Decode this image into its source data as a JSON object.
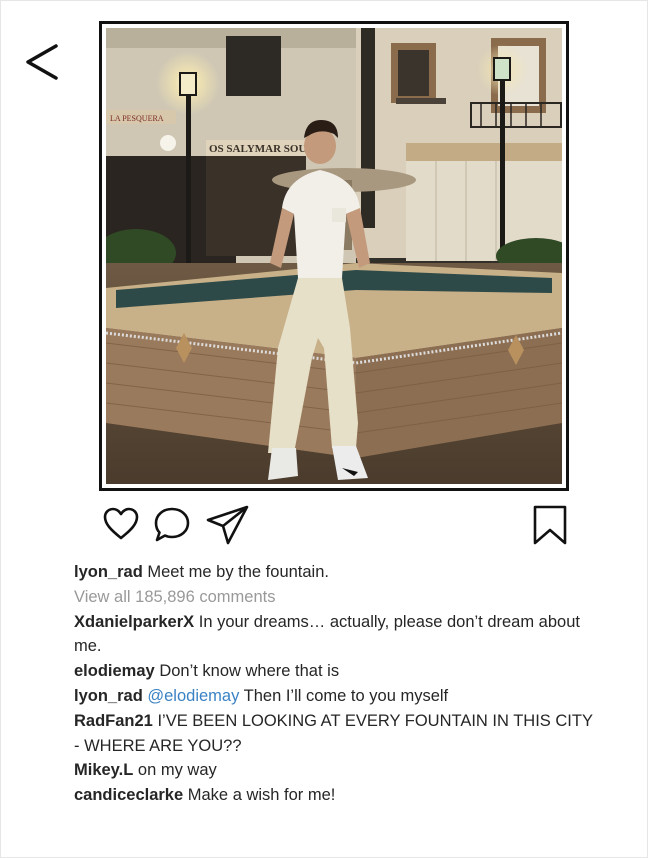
{
  "nav": {
    "back_icon": "chevron-left-icon",
    "back_glyph": "<"
  },
  "post": {
    "image_icon": "photo-image",
    "image_signs": [
      "LA PESQUERA",
      "OS SALYMAR SOU"
    ],
    "actions": [
      "heart-icon",
      "comment-icon",
      "send-icon",
      "bookmark-icon"
    ],
    "caption": {
      "user": "lyon_rad",
      "text": "Meet me by the fountain."
    },
    "view_all": "View all 185,896 comments"
  },
  "comments": [
    {
      "user": "XdanielparkerX",
      "text": "In your dreams… actually, please don’t dream about me."
    },
    {
      "user": "elodiemay",
      "text": "Don’t know where that is"
    },
    {
      "user": "lyon_rad",
      "mention": "@elodiemay",
      "text": "Then I’ll come to you myself"
    },
    {
      "user": "RadFan21",
      "text": "I’VE BEEN LOOKING AT EVERY FOUNTAIN IN THIS CITY - WHERE ARE YOU??"
    },
    {
      "user": "Mikey.L",
      "text": "on my way"
    },
    {
      "user": "candiceclarke",
      "text": "Make a wish for me!"
    }
  ],
  "colors": {
    "mention": "#3b82c4",
    "muted": "#999999",
    "text": "#262626",
    "frame": "#111111"
  }
}
